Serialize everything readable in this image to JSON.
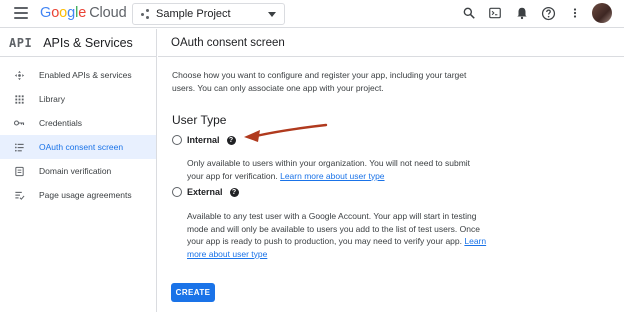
{
  "header": {
    "logo_google": [
      "G",
      "o",
      "o",
      "g",
      "l",
      "e"
    ],
    "logo_cloud": "Cloud",
    "project_name": "Sample Project"
  },
  "icons": {
    "search": "search-icon",
    "shell": "terminal-icon",
    "notifications": "bell-icon",
    "help": "help-icon",
    "more": "more-vert-icon"
  },
  "sidebar": {
    "badge": "API",
    "title": "APIs & Services",
    "items": [
      {
        "label": "Enabled APIs & services",
        "icon": "enabled-apis-icon",
        "active": false
      },
      {
        "label": "Library",
        "icon": "library-icon",
        "active": false
      },
      {
        "label": "Credentials",
        "icon": "key-icon",
        "active": false
      },
      {
        "label": "OAuth consent screen",
        "icon": "consent-icon",
        "active": true
      },
      {
        "label": "Domain verification",
        "icon": "domain-icon",
        "active": false
      },
      {
        "label": "Page usage agreements",
        "icon": "agreements-icon",
        "active": false
      }
    ]
  },
  "main": {
    "title": "OAuth consent screen",
    "intro": "Choose how you want to configure and register your app, including your target users. You can only associate one app with your project.",
    "section_title": "User Type",
    "internal": {
      "label": "Internal",
      "help": "?",
      "description": "Only available to users within your organization. You will not need to submit your app for verification.",
      "link": "Learn more about user type"
    },
    "external": {
      "label": "External",
      "help": "?",
      "description": "Available to any test user with a Google Account. Your app will start in testing mode and will only be available to users you add to the list of test users. Once your app is ready to push to production, you may need to verify your app.",
      "link": "Learn more about user type"
    },
    "create_label": "CREATE"
  },
  "colors": {
    "accent": "#1a73e8",
    "active_bg": "#e8f0fe",
    "annotation_arrow": "#b03a1e"
  }
}
